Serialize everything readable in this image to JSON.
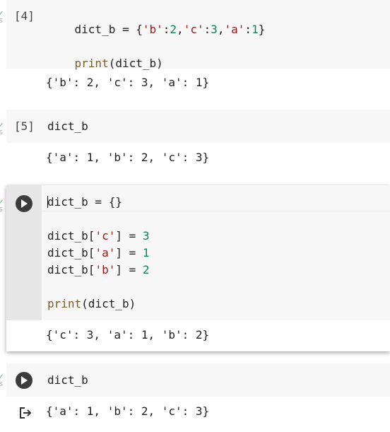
{
  "cells": [
    {
      "exec_count": "[4]",
      "code": [
        [
          "dict_b = {",
          "'b'",
          ":",
          "2",
          ",",
          "'c'",
          ":",
          "3",
          ",",
          "'a'",
          ":",
          "1",
          "}"
        ],
        [
          "print",
          "(dict_b)"
        ]
      ],
      "output": "{'b': 2, 'c': 3, 'a': 1}"
    },
    {
      "exec_count": "[5]",
      "code": "dict_b",
      "output": "{'a': 1, 'b': 2, 'c': 3}"
    },
    {
      "code_line1": "dict_b = {}",
      "assign": [
        {
          "pre": "dict_b[",
          "key": "'c'",
          "post": "] = ",
          "val": "3"
        },
        {
          "pre": "dict_b[",
          "key": "'a'",
          "post": "] = ",
          "val": "1"
        },
        {
          "pre": "dict_b[",
          "key": "'b'",
          "post": "] = ",
          "val": "2"
        }
      ],
      "print_fn": "print",
      "print_arg": "(dict_b)",
      "output": "{'c': 3, 'a': 1, 'b': 2}"
    },
    {
      "code": "dict_b",
      "output": "{'a': 1, 'b': 2, 'c': 3}"
    }
  ],
  "icons": {
    "run": "play-circle-icon",
    "output_redirect": "output-arrow-icon",
    "executed_check": "check-mark-icon"
  },
  "colors": {
    "string": "#a31515",
    "number": "#098658",
    "function": "#795e26",
    "code_background": "#f7f7f7"
  }
}
